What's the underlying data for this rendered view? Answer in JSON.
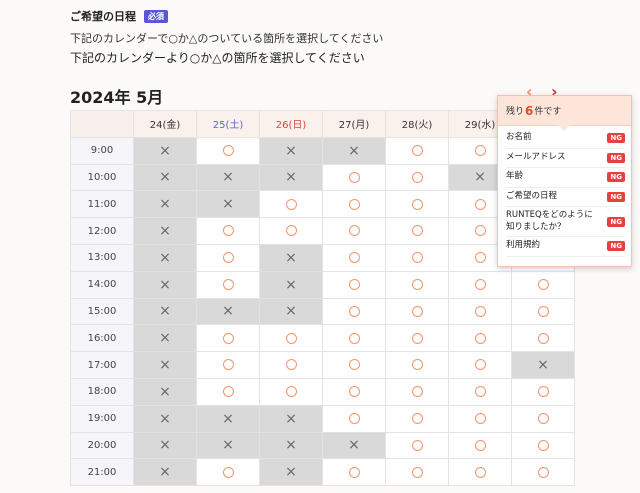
{
  "section": {
    "title": "ご希望の日程",
    "required_badge": "必須"
  },
  "descriptions": [
    "下記のカレンダーで○か△のついている箇所を選択してください",
    "下記のカレンダーより○か△の箇所を選択してください"
  ],
  "calendar": {
    "month_label": "2024年 5月",
    "prev_label": "‹",
    "next_label": "›",
    "days": [
      {
        "label": "24(金)",
        "type": "weekday"
      },
      {
        "label": "25(土)",
        "type": "sat"
      },
      {
        "label": "26(日)",
        "type": "sun"
      },
      {
        "label": "27(月)",
        "type": "weekday"
      },
      {
        "label": "28(火)",
        "type": "weekday"
      },
      {
        "label": "29(水)",
        "type": "weekday"
      },
      {
        "label": "",
        "type": "weekday"
      }
    ],
    "rows": [
      {
        "time": "9:00",
        "slots": [
          "x",
          "o",
          "x",
          "x",
          "o",
          "o",
          "o"
        ]
      },
      {
        "time": "10:00",
        "slots": [
          "x",
          "x",
          "x",
          "o",
          "o",
          "x",
          "o"
        ]
      },
      {
        "time": "11:00",
        "slots": [
          "x",
          "x",
          "o",
          "o",
          "o",
          "o",
          "o"
        ]
      },
      {
        "time": "12:00",
        "slots": [
          "x",
          "o",
          "o",
          "o",
          "o",
          "o",
          "o"
        ]
      },
      {
        "time": "13:00",
        "slots": [
          "x",
          "o",
          "x",
          "o",
          "o",
          "o",
          "o"
        ]
      },
      {
        "time": "14:00",
        "slots": [
          "x",
          "o",
          "x",
          "o",
          "o",
          "o",
          "o"
        ]
      },
      {
        "time": "15:00",
        "slots": [
          "x",
          "x",
          "x",
          "o",
          "o",
          "o",
          "o"
        ]
      },
      {
        "time": "16:00",
        "slots": [
          "x",
          "o",
          "o",
          "o",
          "o",
          "o",
          "o"
        ]
      },
      {
        "time": "17:00",
        "slots": [
          "x",
          "o",
          "o",
          "o",
          "o",
          "o",
          "x"
        ]
      },
      {
        "time": "18:00",
        "slots": [
          "x",
          "o",
          "o",
          "o",
          "o",
          "o",
          "o"
        ]
      },
      {
        "time": "19:00",
        "slots": [
          "x",
          "x",
          "x",
          "o",
          "o",
          "o",
          "o"
        ]
      },
      {
        "time": "20:00",
        "slots": [
          "x",
          "x",
          "x",
          "x",
          "o",
          "o",
          "o"
        ]
      },
      {
        "time": "21:00",
        "slots": [
          "x",
          "o",
          "x",
          "o",
          "o",
          "o",
          "o"
        ]
      }
    ],
    "available_symbol": "circle-icon",
    "unavailable_symbol": "cross-icon"
  },
  "popup": {
    "prefix": "残り",
    "count": "6",
    "suffix": "件です",
    "items": [
      {
        "label": "お名前",
        "status": "NG"
      },
      {
        "label": "メールアドレス",
        "status": "NG"
      },
      {
        "label": "年齢",
        "status": "NG"
      },
      {
        "label": "ご希望の日程",
        "status": "NG"
      },
      {
        "label": "RUNTEQをどのように知りましたか？",
        "status": "NG"
      },
      {
        "label": "利用規約",
        "status": "NG"
      }
    ]
  },
  "colors": {
    "accent": "#5a54d6",
    "available": "#f1966f",
    "unavailable_bg": "#d9d9d9",
    "ng": "#e5413d",
    "saturday": "#5567c9",
    "sunday": "#d8473d"
  }
}
